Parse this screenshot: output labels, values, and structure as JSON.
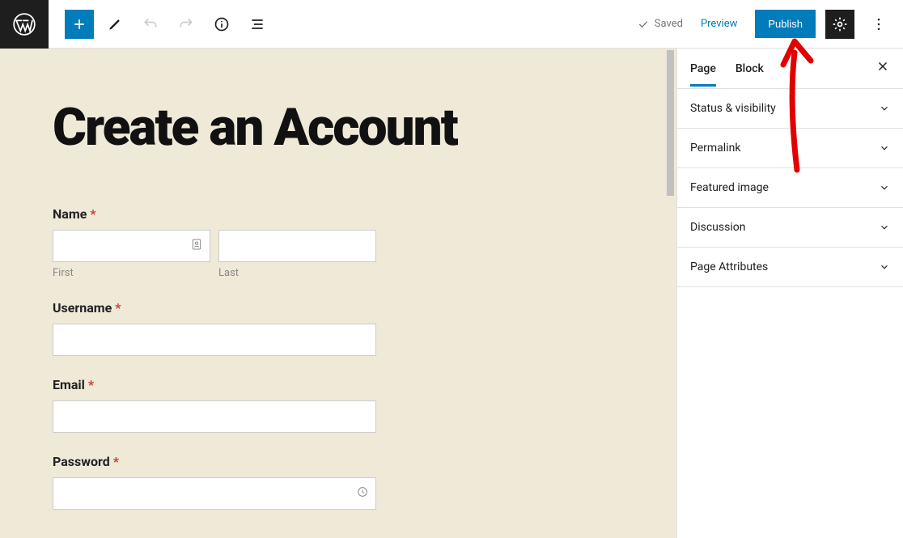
{
  "topbar": {
    "saved_label": "Saved",
    "preview_label": "Preview",
    "publish_label": "Publish"
  },
  "canvas": {
    "title": "Create an Account",
    "fields": {
      "name_label": "Name",
      "first_sub": "First",
      "last_sub": "Last",
      "username_label": "Username",
      "email_label": "Email",
      "password_label": "Password"
    }
  },
  "sidebar": {
    "tabs": {
      "page": "Page",
      "block": "Block"
    },
    "panels": [
      "Status & visibility",
      "Permalink",
      "Featured image",
      "Discussion",
      "Page Attributes"
    ]
  }
}
